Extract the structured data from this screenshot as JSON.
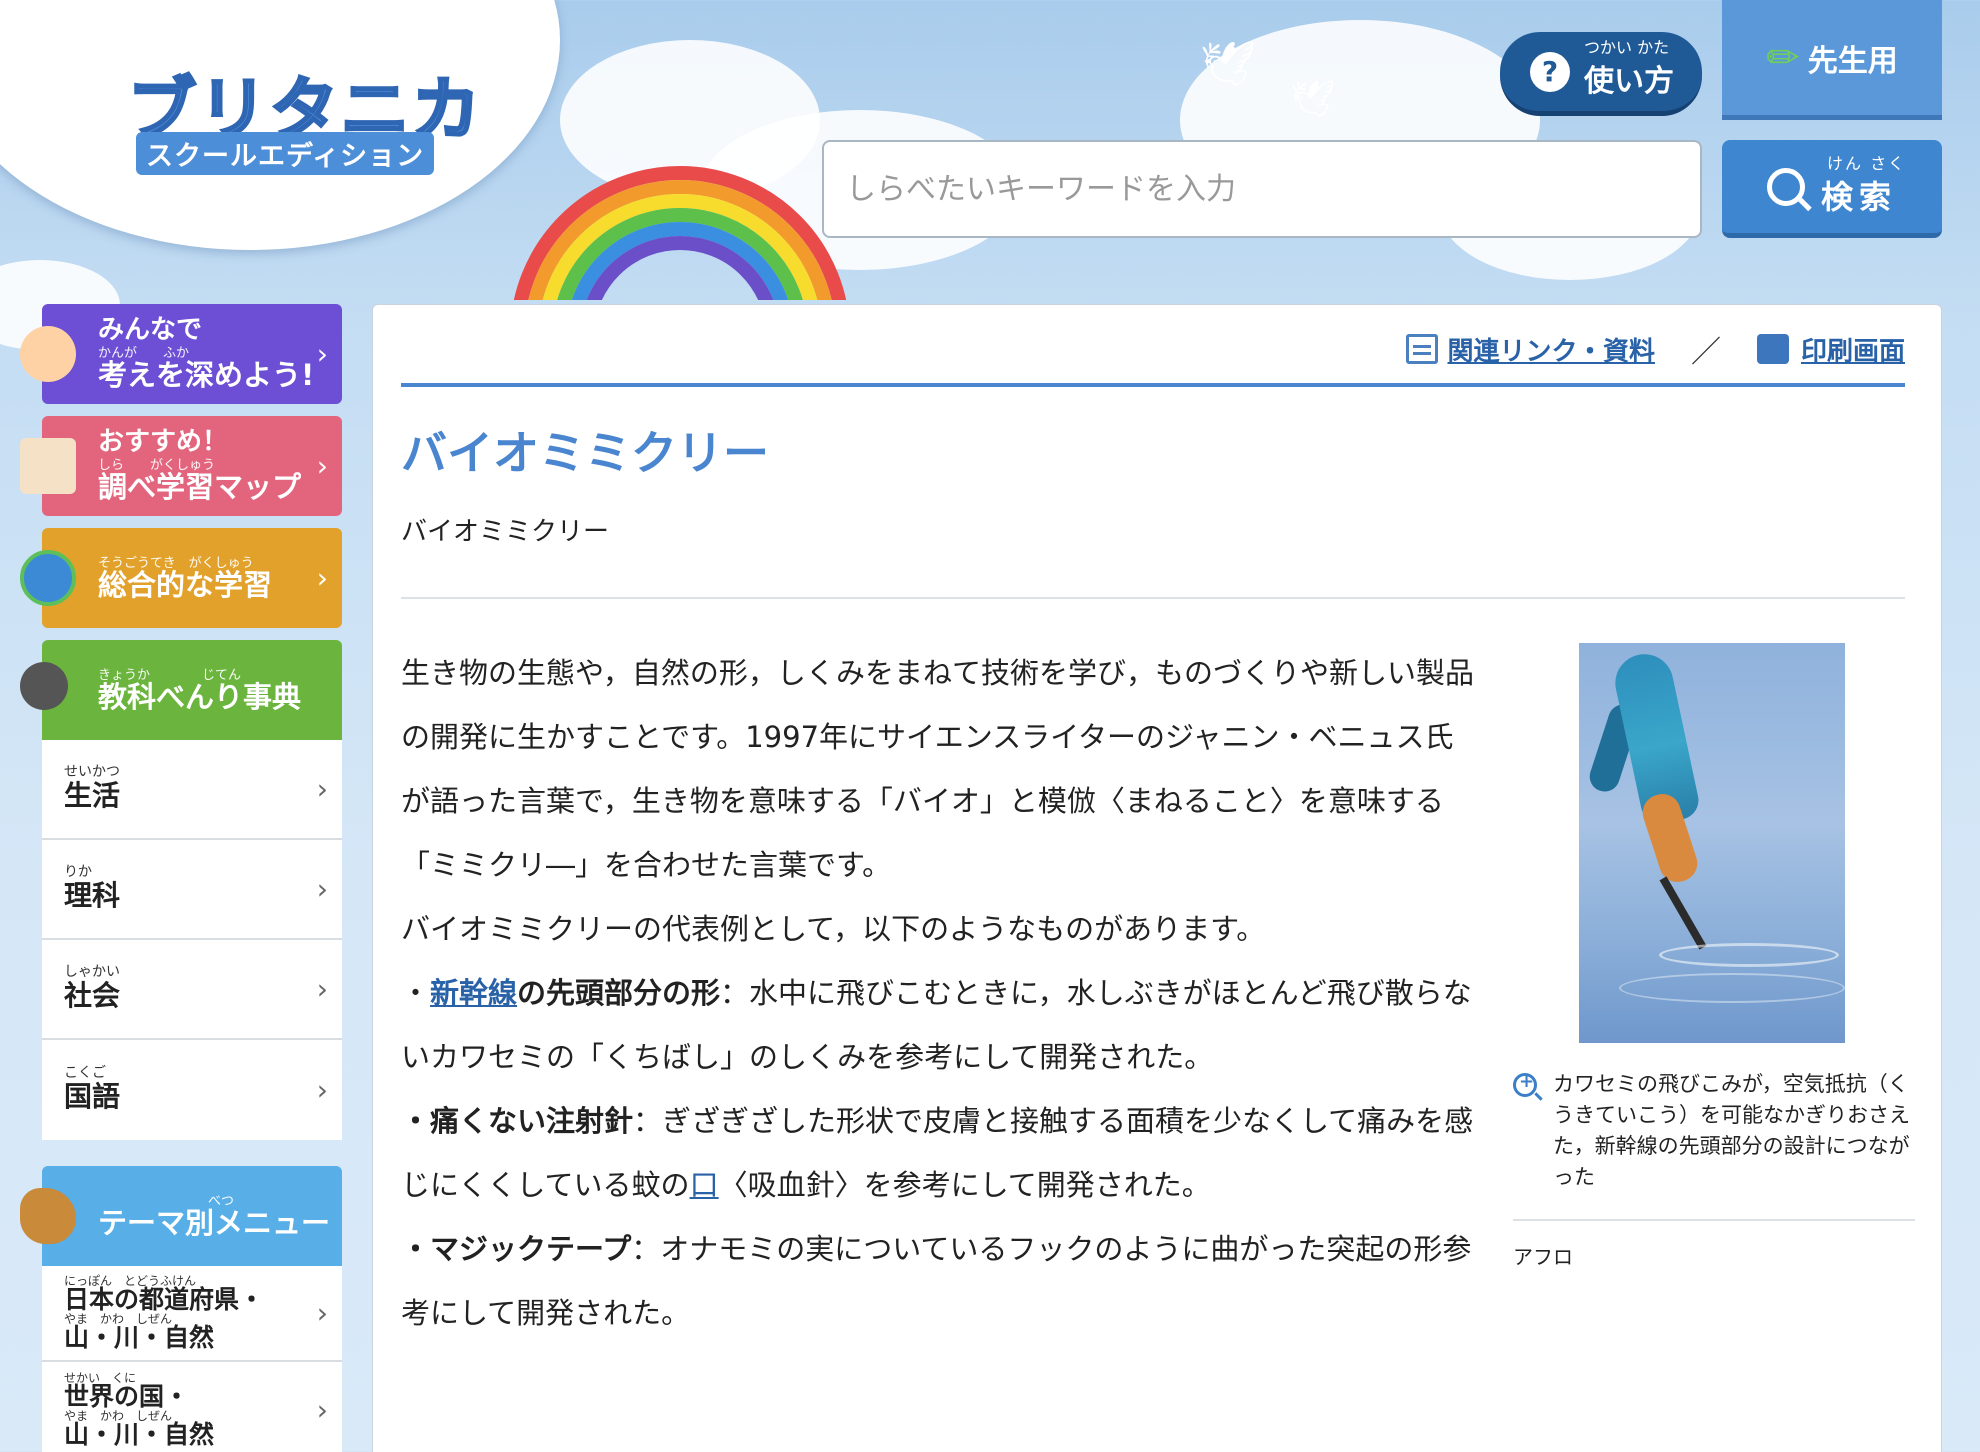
{
  "brand": {
    "logo_main": "ブリタニカ",
    "logo_sub": "スクールエディション"
  },
  "header": {
    "howto_ruby": "つかい かた",
    "howto_label": "使い方",
    "teacher_label": "先生用",
    "search_placeholder": "しらべたいキーワードを入力",
    "search_ruby": "けん さく",
    "search_label": "検索"
  },
  "sidebar": {
    "cards": [
      {
        "line1": "みんなで",
        "ruby": "かんが　　ふか",
        "line2": "考えを深めよう!"
      },
      {
        "line1": "おすすめ！",
        "ruby": "しら　　がくしゅう",
        "line2": "調べ学習マップ"
      },
      {
        "line1": "",
        "ruby": "そうごうてき　がくしゅう",
        "line2": "総合的な学習"
      },
      {
        "line1": "",
        "ruby": "きょうか　　　　じてん",
        "line2": "教科べんり事典"
      }
    ],
    "subjects": [
      {
        "ruby": "せいかつ",
        "name": "生活"
      },
      {
        "ruby": "りか",
        "name": "理科"
      },
      {
        "ruby": "しゃかい",
        "name": "社会"
      },
      {
        "ruby": "こくご",
        "name": "国語"
      }
    ],
    "theme_ruby": "べつ",
    "theme_label": "テーマ別メニュー",
    "theme_items": [
      {
        "ruby1": "にっぽん　とどうふけん",
        "line1": "日本の都道府県・",
        "ruby2": "やま　かわ　しぜん",
        "line2": "山・川・自然"
      },
      {
        "ruby1": "せかい　くに",
        "line1": "世界の国・",
        "ruby2": "やま　かわ　しぜん",
        "line2": "山・川・自然"
      }
    ]
  },
  "toplinks": {
    "related": "関連リンク・資料",
    "separator": "／",
    "print": "印刷画面"
  },
  "article": {
    "title": "バイオミミクリー",
    "subtitle": "バイオミミクリー",
    "para1": "生き物の生態や，自然の形，しくみをまねて技術を学び，ものづくりや新しい製品の開発に生かすことです。1997年にサイエンスライターのジャニン・ベニュス氏が語った言葉で，生き物を意味する「バイオ」と模倣〈まねること〉を意味する「ミミクリ―」を合わせた言葉です。",
    "para2": "バイオミミクリーの代表例として，以下のようなものがあります。",
    "item1_bullet": "・",
    "item1_link": "新幹線",
    "item1_bold": "の先頭部分の形",
    "item1_text": "：水中に飛びこむときに，水しぶきがほとんど飛び散らないカワセミの「くちばし」のしくみを参考にして開発された。",
    "item2_bold": "・痛くない注射針",
    "item2_text_a": "：ぎざぎざした形状で皮膚と接触する面積を少なくして痛みを感じにくくしている蚊の",
    "item2_link": "口",
    "item2_text_b": "〈吸血針〉を参考にして開発された。",
    "item3_bold": "・マジックテープ",
    "item3_text": "：オナモミの実についているフックのように曲がった突起の形参考にして開発された。"
  },
  "figure": {
    "caption": "カワセミの飛びこみが，空気抵抗（くうきていこう）を可能なかぎりおさえた，新幹線の先頭部分の設計につながった",
    "credit": "アフロ"
  }
}
